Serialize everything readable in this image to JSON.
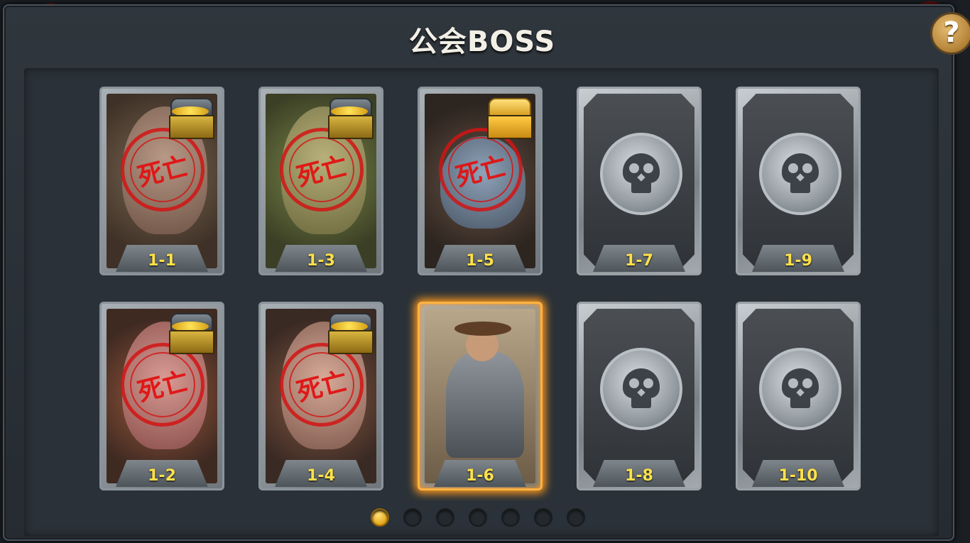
{
  "title": "公会BOSS",
  "help_label": "?",
  "stamp_text": "死亡",
  "colors": {
    "label_yellow": "#ffe14a",
    "stamp_red": "#e11212",
    "active_glow": "#ff9a1e",
    "page_dot_active": "#e5a418"
  },
  "stages": [
    {
      "label": "1-1",
      "state": "defeated",
      "reward": "chest-silver"
    },
    {
      "label": "1-3",
      "state": "defeated",
      "reward": "chest-silver"
    },
    {
      "label": "1-5",
      "state": "defeated",
      "reward": "chest-gold"
    },
    {
      "label": "1-7",
      "state": "locked",
      "icon": "skull-icon"
    },
    {
      "label": "1-9",
      "state": "locked",
      "icon": "skull-icon"
    },
    {
      "label": "1-2",
      "state": "defeated",
      "reward": "chest-silver"
    },
    {
      "label": "1-4",
      "state": "defeated",
      "reward": "chest-silver"
    },
    {
      "label": "1-6",
      "state": "current"
    },
    {
      "label": "1-8",
      "state": "locked",
      "icon": "skull-icon"
    },
    {
      "label": "1-10",
      "state": "locked",
      "icon": "skull-icon"
    }
  ],
  "pagination": {
    "total": 7,
    "current": 1
  }
}
